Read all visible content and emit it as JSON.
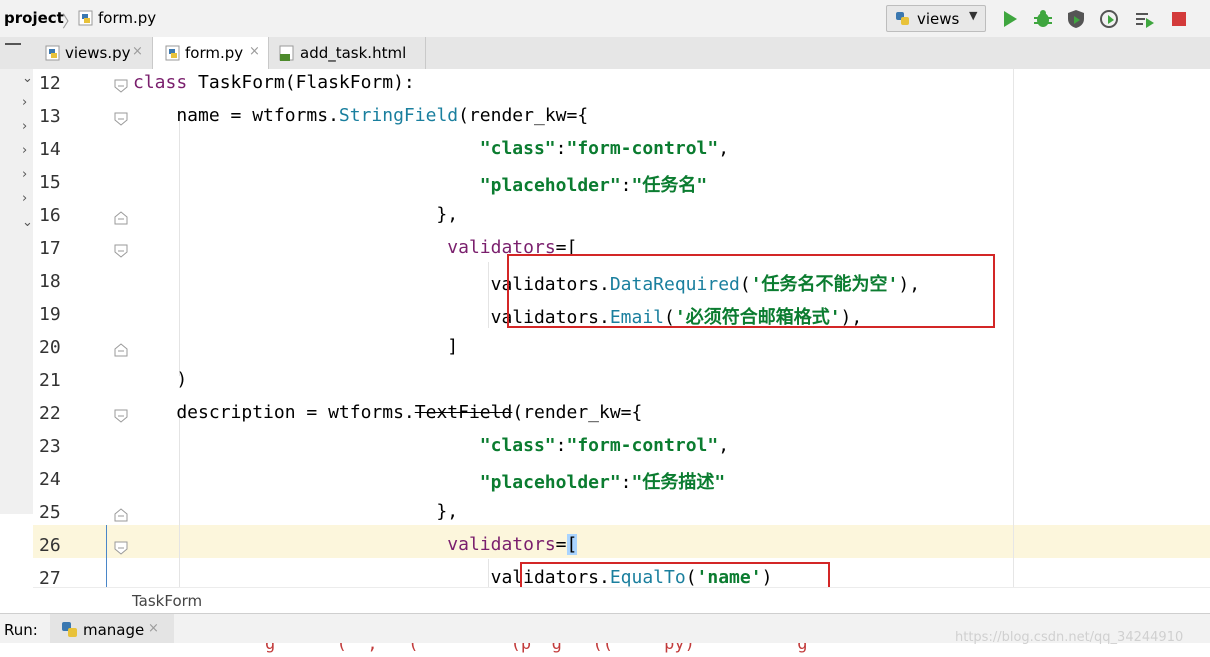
{
  "navbar": {
    "project": "project",
    "file": "form.py",
    "run_config": "views"
  },
  "tabs": [
    {
      "label": "views.py",
      "active": false
    },
    {
      "label": "form.py",
      "active": true
    },
    {
      "label": "add_task.html",
      "active": false
    }
  ],
  "close_glyph": "×",
  "editor": {
    "lines": [
      {
        "n": "12",
        "parts": [
          [
            "kw",
            "class "
          ],
          [
            "",
            "TaskForm(FlaskForm):"
          ]
        ]
      },
      {
        "n": "13",
        "parts": [
          [
            "",
            "    name = wtforms."
          ],
          [
            "fn",
            "StringField"
          ],
          [
            "",
            "(render_kw={"
          ]
        ]
      },
      {
        "n": "14",
        "parts": [
          [
            "",
            "                                "
          ],
          [
            "str",
            "\"class\""
          ],
          [
            "",
            ":"
          ],
          [
            "str",
            "\"form-control\""
          ],
          [
            "",
            ","
          ]
        ]
      },
      {
        "n": "15",
        "parts": [
          [
            "",
            "                                "
          ],
          [
            "str",
            "\"placeholder\""
          ],
          [
            "",
            ":"
          ],
          [
            "str",
            "\"任务名\""
          ]
        ]
      },
      {
        "n": "16",
        "parts": [
          [
            "",
            "                            },"
          ]
        ]
      },
      {
        "n": "17",
        "parts": [
          [
            "",
            "                             "
          ],
          [
            "kw",
            "validators"
          ],
          [
            "",
            "=["
          ]
        ]
      },
      {
        "n": "18",
        "parts": [
          [
            "",
            "                                 validators."
          ],
          [
            "fn",
            "DataRequired"
          ],
          [
            "",
            "("
          ],
          [
            "str",
            "'任务名不能为空'"
          ],
          [
            "",
            "),"
          ]
        ]
      },
      {
        "n": "19",
        "parts": [
          [
            "",
            "                                 validators."
          ],
          [
            "fn",
            "Email"
          ],
          [
            "",
            "("
          ],
          [
            "str",
            "'必须符合邮箱格式'"
          ],
          [
            "",
            "),"
          ]
        ]
      },
      {
        "n": "20",
        "parts": [
          [
            "",
            "                             ]"
          ]
        ]
      },
      {
        "n": "21",
        "parts": [
          [
            "",
            "    )"
          ]
        ]
      },
      {
        "n": "22",
        "parts": [
          [
            "",
            "    description = wtforms."
          ],
          [
            "strike",
            "TextField"
          ],
          [
            "",
            "(render_kw={"
          ]
        ]
      },
      {
        "n": "23",
        "parts": [
          [
            "",
            "                                "
          ],
          [
            "str",
            "\"class\""
          ],
          [
            "",
            ":"
          ],
          [
            "str",
            "\"form-control\""
          ],
          [
            "",
            ","
          ]
        ]
      },
      {
        "n": "24",
        "parts": [
          [
            "",
            "                                "
          ],
          [
            "str",
            "\"placeholder\""
          ],
          [
            "",
            ":"
          ],
          [
            "str",
            "\"任务描述\""
          ]
        ]
      },
      {
        "n": "25",
        "parts": [
          [
            "",
            "                            },"
          ]
        ]
      },
      {
        "n": "26",
        "parts": [
          [
            "",
            "                             "
          ],
          [
            "kw",
            "validators"
          ],
          [
            "",
            "="
          ],
          [
            "cur",
            "["
          ]
        ]
      },
      {
        "n": "27",
        "parts": [
          [
            "",
            "                                 validators."
          ],
          [
            "fn",
            "EqualTo"
          ],
          [
            "",
            "("
          ],
          [
            "str",
            "'name'"
          ],
          [
            "",
            ")"
          ]
        ]
      }
    ]
  },
  "code_breadcrumb": "TaskForm",
  "run_panel": {
    "label": "Run:",
    "tab": "manage"
  },
  "console_partial": "g      (  ,   (         (p  g   ((     py)          g",
  "watermark": "https://blog.csdn.net/qq_34244910",
  "colors": {
    "keyword": "#7a1f6d",
    "string": "#0b7c30",
    "function": "#1a7f9e",
    "highlight_box": "#d32626",
    "caret_row": "#fcf6dc"
  }
}
